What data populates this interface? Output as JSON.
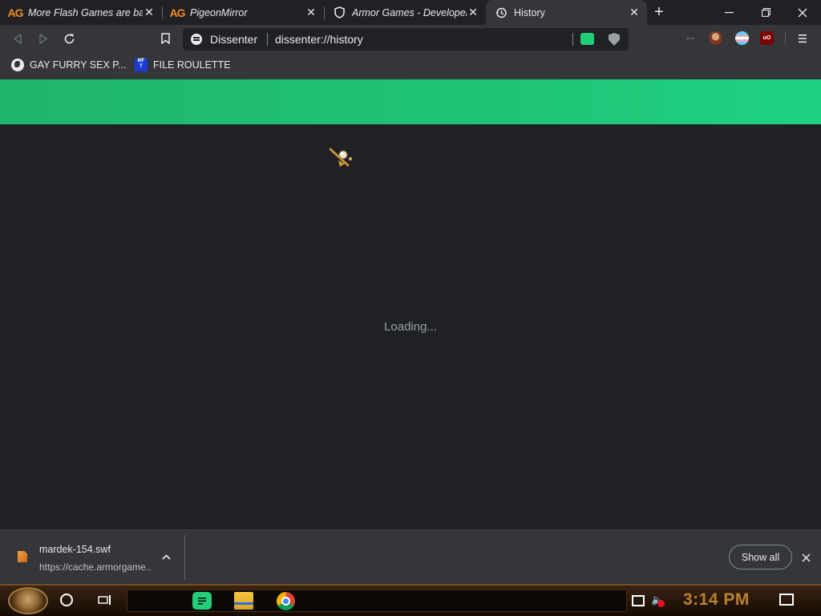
{
  "tabs": [
    {
      "title": "More Flash Games are back",
      "icon": "armor-games-logo",
      "active": false
    },
    {
      "title": "PigeonMirror",
      "icon": "armor-games-logo",
      "active": false
    },
    {
      "title": "Armor Games - Developer",
      "icon": "shield-icon",
      "active": false
    },
    {
      "title": "History",
      "icon": "history-icon",
      "active": true
    }
  ],
  "tab_icon_text": "AG",
  "omnibox": {
    "site_name": "Dissenter",
    "url": "dissenter://history"
  },
  "bookmarks": [
    {
      "label": "GAY FURRY SEX P...",
      "icon": "globe-icon"
    },
    {
      "label": "FILE ROULETTE",
      "icon": "mft-icon",
      "icon_text": "MF\nT"
    }
  ],
  "page": {
    "banner_color": "#1fc475",
    "loading_text": "Loading..."
  },
  "download_shelf": {
    "filename": "mardek-154.swf",
    "source_url": "https://cache.armorgame...",
    "show_all_label": "Show all"
  },
  "taskbar": {
    "clock": "3:14 PM",
    "pinned_apps": [
      "gab-dissenter-icon",
      "file-explorer-icon",
      "chrome-icon"
    ]
  },
  "colors": {
    "accent_green": "#21cf7a",
    "clock": "#b8822f"
  }
}
